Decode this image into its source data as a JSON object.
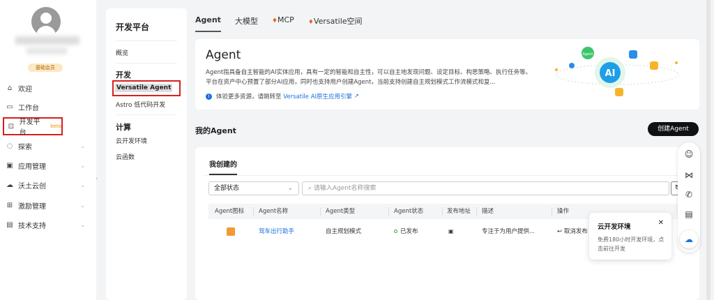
{
  "user": {
    "badge": "基础会员"
  },
  "sidebar": {
    "items": [
      {
        "label": "欢迎",
        "icon": "home-icon"
      },
      {
        "label": "工作台",
        "icon": "desk-icon"
      },
      {
        "label": "开发平台",
        "icon": "dev-icon",
        "tag": "beta"
      },
      {
        "label": "探索",
        "icon": "explore-icon"
      },
      {
        "label": "应用管理",
        "icon": "app-icon"
      },
      {
        "label": "沃土云创",
        "icon": "cloud-icon"
      },
      {
        "label": "激励管理",
        "icon": "reward-icon"
      },
      {
        "label": "技术支持",
        "icon": "support-icon"
      }
    ]
  },
  "subnav": {
    "title": "开发平台",
    "overview": "概览",
    "dev_heading": "开发",
    "dev_items": [
      "Versatile Agent",
      "Astro 低代码开发"
    ],
    "compute_heading": "计算",
    "compute_items": [
      "云开发环境",
      "云函数"
    ]
  },
  "tabs": [
    "Agent",
    "大模型",
    "MCP",
    "Versatile空间"
  ],
  "intro": {
    "title": "Agent",
    "desc": "Agent指具备自主智能的AI实体应用，具有一定的智能和自主性，可以自主地发现问题、设定目标、构思策略、执行任务等。平台在资产中心预置了部分AI应用，同时也支持用户创建Agent，当前支持创建自主规划模式工作流模式和复...",
    "tip": "体验更多资源，请跳转至",
    "tip_link": "Versatile AI原生应用引擎",
    "hero_labels": [
      "Agent",
      "AI"
    ]
  },
  "section": {
    "title": "我的Agent",
    "create": "创建Agent"
  },
  "list": {
    "tab": "我创建的",
    "status_filter": "全部状态",
    "search_placeholder": "请输入Agent名称搜索",
    "columns": [
      "Agent图标",
      "Agent名称",
      "Agent类型",
      "Agent状态",
      "发布地址",
      "描述",
      "操作"
    ],
    "rows": [
      {
        "name": "驾车出行助手",
        "type": "自主规划模式",
        "status": "已发布",
        "desc": "专注于为用户提供...",
        "action": "取消发布"
      }
    ]
  },
  "popup": {
    "title": "云开发环境",
    "desc": "免费180小时开发环境，点击前往开发"
  },
  "colors": {
    "accent": "#1a6fe0",
    "red": "#d81e1e",
    "orange": "#f29a34"
  }
}
